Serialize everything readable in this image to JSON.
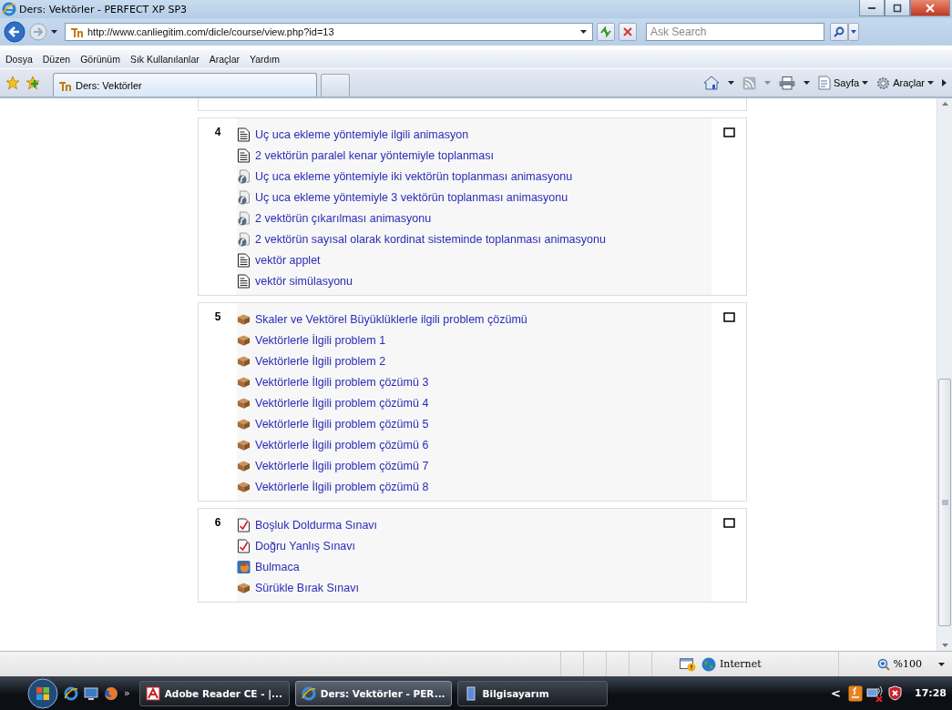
{
  "window": {
    "title": "Ders: Vektörler - PERFECT XP SP3"
  },
  "address_bar": {
    "url": "http://www.canliegitim.com/dicle/course/view.php?id=13"
  },
  "search": {
    "placeholder": "Ask Search"
  },
  "menu": [
    "Dosya",
    "Düzen",
    "Görünüm",
    "Sık Kullanılanlar",
    "Araçlar",
    "Yardım"
  ],
  "tabs": [
    {
      "label": "Ders: Vektörler",
      "selected": true
    }
  ],
  "command_bar": [
    "Sayfa",
    "Araçlar"
  ],
  "sections": [
    {
      "number": "4",
      "items": [
        {
          "kind": "page",
          "label": "Uç uca ekleme yöntemiyle ilgili animasyon"
        },
        {
          "kind": "page",
          "label": "2 vektörün paralel kenar yöntemiyle toplanması"
        },
        {
          "kind": "flash",
          "label": "Uç uca ekleme yöntemiyle iki vektörün toplanması animasyonu"
        },
        {
          "kind": "flash",
          "label": "Uç uca ekleme yöntemiyle 3 vektörün toplanması animasyonu"
        },
        {
          "kind": "flash",
          "label": "2 vektörün çıkarılması animasyonu"
        },
        {
          "kind": "flash",
          "label": "2 vektörün sayısal olarak kordinat sisteminde toplanması animasyonu"
        },
        {
          "kind": "page",
          "label": "vektör applet"
        },
        {
          "kind": "page",
          "label": "vektör simülasyonu"
        }
      ]
    },
    {
      "number": "5",
      "items": [
        {
          "kind": "package",
          "label": "Skaler ve Vektörel Büyüklüklerle ilgili problem çözümü"
        },
        {
          "kind": "package",
          "label": "Vektörlerle İlgili problem 1"
        },
        {
          "kind": "package",
          "label": "Vektörlerle İlgili problem 2"
        },
        {
          "kind": "package",
          "label": "Vektörlerle İlgili problem çözümü 3"
        },
        {
          "kind": "package",
          "label": "Vektörlerle İlgili problem çözümü 4"
        },
        {
          "kind": "package",
          "label": "Vektörlerle İlgili problem çözümü 5"
        },
        {
          "kind": "package",
          "label": "Vektörlerle İlgili problem çözümü 6"
        },
        {
          "kind": "package",
          "label": "Vektörlerle İlgili problem çözümü 7"
        },
        {
          "kind": "package",
          "label": "Vektörlerle İlgili problem çözümü 8"
        }
      ]
    },
    {
      "number": "6",
      "items": [
        {
          "kind": "quiz",
          "label": "Boşluk Doldurma Sınavı"
        },
        {
          "kind": "quiz",
          "label": "Doğru Yanlış Sınavı"
        },
        {
          "kind": "puzzle",
          "label": "Bulmaca"
        },
        {
          "kind": "package",
          "label": "Sürükle Bırak Sınavı"
        }
      ]
    }
  ],
  "status_bar": {
    "zone": "Internet",
    "zoom": "%100"
  },
  "taskbar": {
    "tasks": [
      {
        "kind": "pdf",
        "label": "Adobe Reader CE - |...",
        "selected": false
      },
      {
        "kind": "ie",
        "label": "Ders: Vektörler - PER...",
        "selected": true
      },
      {
        "kind": "computer",
        "label": "Bilgisayarım",
        "selected": false
      }
    ],
    "overflow": "»",
    "tray_arrow": "<",
    "time": "17:28"
  }
}
